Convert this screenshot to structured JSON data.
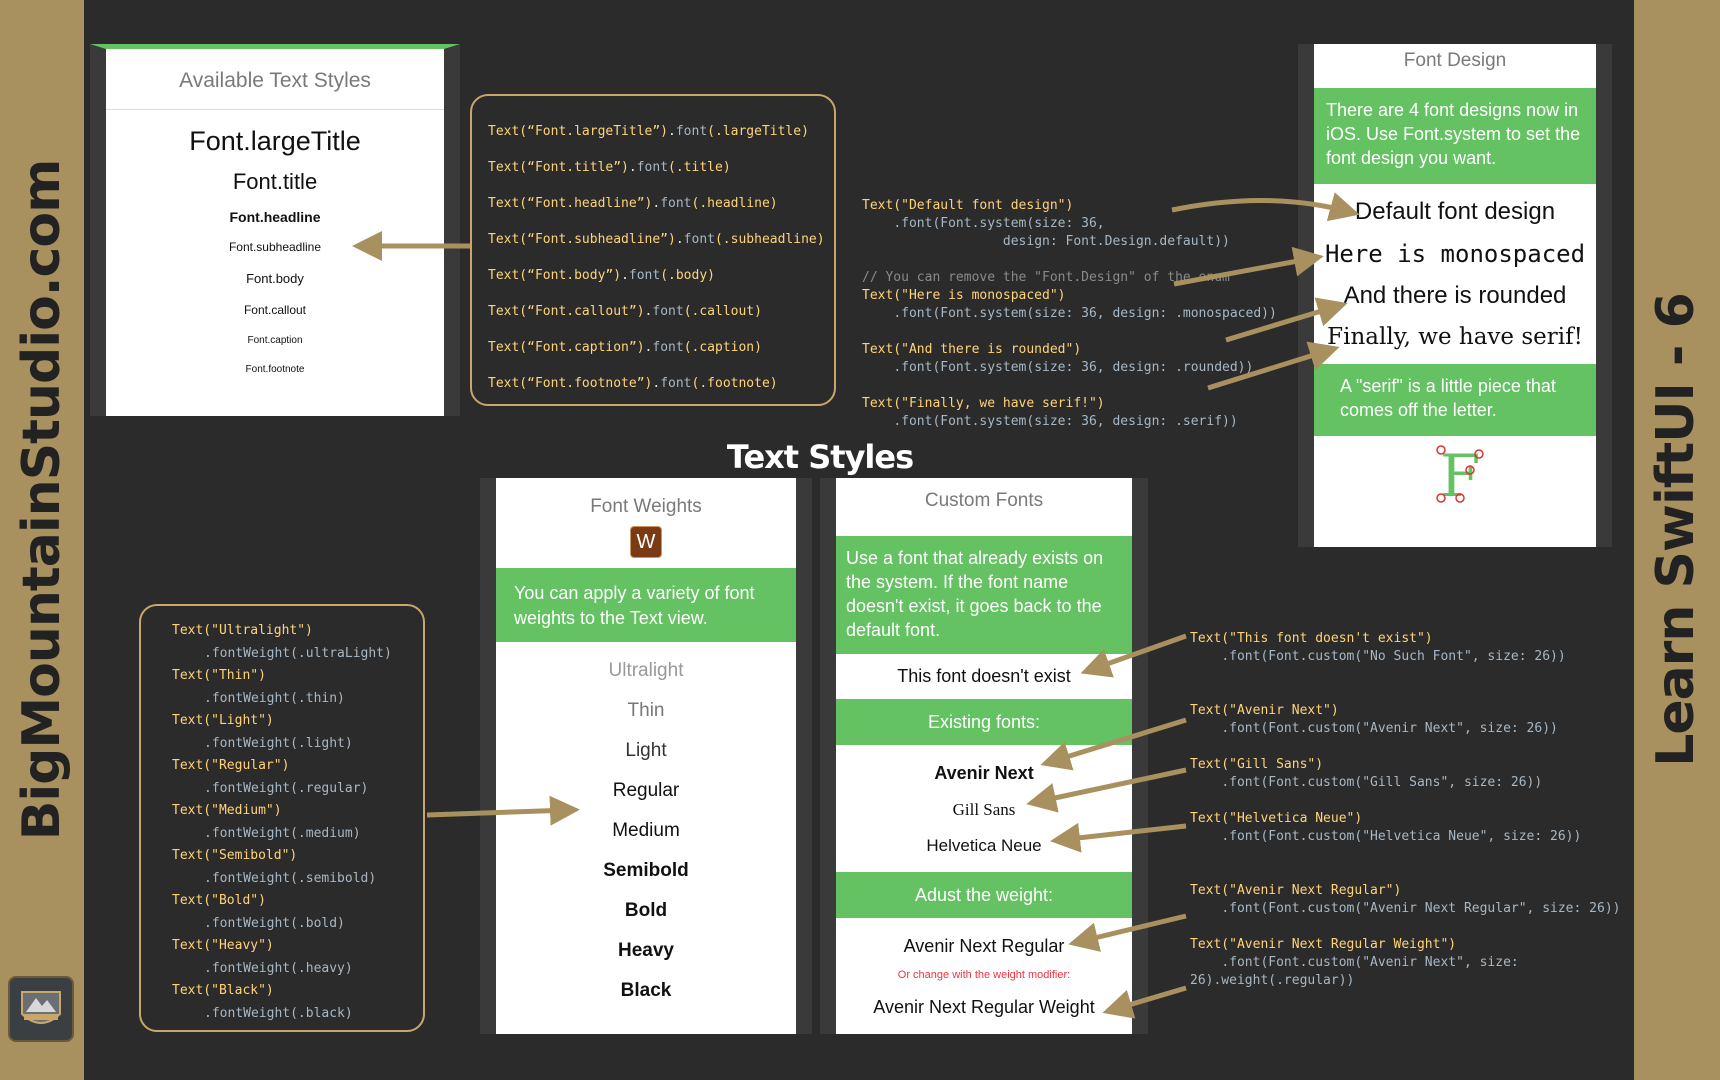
{
  "branding": {
    "site": "BigMountainStudio.com",
    "series": "Learn SwiftUI - 6",
    "logo_icon": "mountain-badge-icon",
    "colors": {
      "gold": "#a9915f",
      "background": "#2b2b2b",
      "green": "#64c262",
      "code_string": "#ffd479",
      "code_keyword": "#ff8a3d"
    }
  },
  "heading": "Text Styles",
  "text_styles_phone": {
    "title": "Available Text Styles",
    "items": [
      "Font.largeTitle",
      "Font.title",
      "Font.headline",
      "Font.subheadline",
      "Font.body",
      "Font.callout",
      "Font.caption",
      "Font.footnote"
    ]
  },
  "text_styles_code": [
    {
      "str": "Text(“Font.largeTitle”)",
      "fn": "font",
      "arg": "(.largeTitle)"
    },
    {
      "str": "Text(“Font.title”)",
      "fn": "font",
      "arg": "(.title)"
    },
    {
      "str": "Text(“Font.headline”)",
      "fn": "font",
      "arg": "(.headline)"
    },
    {
      "str": "Text(“Font.subheadline”)",
      "fn": "font",
      "arg": "(.subheadline)"
    },
    {
      "str": "Text(“Font.body”)",
      "fn": "font",
      "arg": "(.body)"
    },
    {
      "str": "Text(“Font.callout”)",
      "fn": "font",
      "arg": "(.callout)"
    },
    {
      "str": "Text(“Font.caption”)",
      "fn": "font",
      "arg": "(.caption)"
    },
    {
      "str": "Text(“Font.footnote”)",
      "fn": "font",
      "arg": "(.footnote)"
    }
  ],
  "font_design_phone": {
    "title": "Font Design",
    "intro": "There are 4 font designs now in iOS. Use Font.system to set the font design you want.",
    "samples": [
      "Default font design",
      "Here is monospaced",
      "And there is rounded",
      "Finally, we have serif!"
    ],
    "serif_note": "A \"serif\" is a little piece that comes off the letter.",
    "serif_letter": "F"
  },
  "font_design_code": {
    "default_text": "Text(\"Default font design\")",
    "default_font": ".font(Font.system(size: 36,",
    "default_design": "design: Font.Design.default))",
    "comment": "// You can remove the \"Font.Design\" of the enum",
    "mono_text": "Text(\"Here is monospaced\")",
    "mono_font": ".font(Font.system(size: 36, design: .monospaced))",
    "rounded_text": "Text(\"And there is rounded\")",
    "rounded_font": ".font(Font.system(size: 36, design: .rounded))",
    "serif_text": "Text(\"Finally, we have serif!\")",
    "serif_font": ".font(Font.system(size: 36, design: .serif))"
  },
  "font_weights_phone": {
    "title": "Font Weights",
    "icon_letter": "W",
    "intro": "You can apply a variety of font weights to the Text view.",
    "weights": [
      "Ultralight",
      "Thin",
      "Light",
      "Regular",
      "Medium",
      "Semibold",
      "Bold",
      "Heavy",
      "Black"
    ]
  },
  "font_weights_code": [
    {
      "text": "Text(\"Ultralight\")",
      "mod": ".fontWeight(.ultraLight)"
    },
    {
      "text": "Text(\"Thin\")",
      "mod": ".fontWeight(.thin)"
    },
    {
      "text": "Text(\"Light\")",
      "mod": ".fontWeight(.light)"
    },
    {
      "text": "Text(\"Regular\")",
      "mod": ".fontWeight(.regular)"
    },
    {
      "text": "Text(\"Medium\")",
      "mod": ".fontWeight(.medium)"
    },
    {
      "text": "Text(\"Semibold\")",
      "mod": ".fontWeight(.semibold)"
    },
    {
      "text": "Text(\"Bold\")",
      "mod": ".fontWeight(.bold)"
    },
    {
      "text": "Text(\"Heavy\")",
      "mod": ".fontWeight(.heavy)"
    },
    {
      "text": "Text(\"Black\")",
      "mod": ".fontWeight(.black)"
    }
  ],
  "custom_fonts_phone": {
    "title": "Custom Fonts",
    "intro": "Use a font that already exists on the system. If the font name doesn't exist, it goes back to the default font.",
    "missing": "This font doesn't exist",
    "existing_header": "Existing fonts:",
    "existing": [
      "Avenir Next",
      "Gill Sans",
      "Helvetica Neue"
    ],
    "weight_header": "Adust the weight:",
    "regular": "Avenir Next Regular",
    "modifier_note": "Or change with the weight modifier:",
    "regular_weight": "Avenir Next Regular Weight"
  },
  "custom_fonts_code": {
    "c1_text": "Text(\"This font doesn't exist\")",
    "c1_font": ".font(Font.custom(\"No Such Font\", size: 26))",
    "c2_text": "Text(\"Avenir Next\")",
    "c2_font": ".font(Font.custom(\"Avenir Next\", size: 26))",
    "c3_text": "Text(\"Gill Sans\")",
    "c3_font": ".font(Font.custom(\"Gill Sans\", size: 26))",
    "c4_text": "Text(\"Helvetica Neue\")",
    "c4_font": ".font(Font.custom(\"Helvetica Neue\", size: 26))",
    "c5_text": "Text(\"Avenir Next Regular\")",
    "c5_font": ".font(Font.custom(\"Avenir Next Regular\", size: 26))",
    "c6_text": "Text(\"Avenir Next Regular Weight\")",
    "c6_font": ".font(Font.custom(\"Avenir Next\", size:",
    "c6_weight": "26).weight(.regular))"
  }
}
